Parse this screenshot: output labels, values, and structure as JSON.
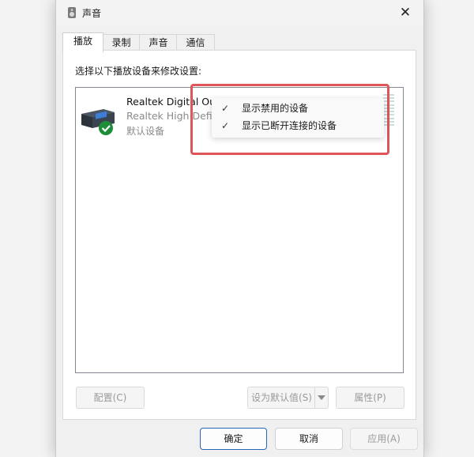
{
  "window": {
    "title": "声音"
  },
  "tabs": [
    {
      "label": "播放"
    },
    {
      "label": "录制"
    },
    {
      "label": "声音"
    },
    {
      "label": "通信"
    }
  ],
  "panel": {
    "instruction": "选择以下播放设备来修改设置:",
    "devices": [
      {
        "name": "Realtek Digital Output",
        "driver": "Realtek High Definition Audio",
        "status": "默认设备",
        "icon": "speaker-device-icon",
        "default_badge": "check-icon"
      }
    ]
  },
  "context_menu": {
    "items": [
      {
        "label": "显示禁用的设备",
        "checked": true
      },
      {
        "label": "显示已断开连接的设备",
        "checked": true
      }
    ]
  },
  "panel_buttons": {
    "configure": "配置(C)",
    "set_default": "设为默认值(S)",
    "properties": "属性(P)"
  },
  "dialog_buttons": {
    "ok": "确定",
    "cancel": "取消",
    "apply": "应用(A)"
  },
  "colors": {
    "highlight_border": "#e05557",
    "primary_button_border": "#2b65b7",
    "check_badge": "#1e8d3a"
  }
}
